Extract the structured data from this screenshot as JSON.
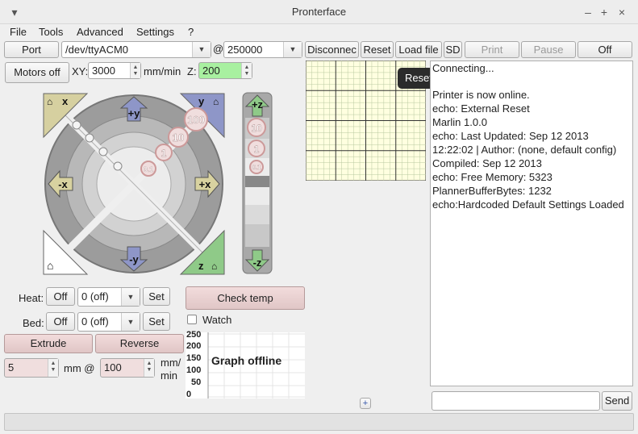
{
  "window": {
    "title": "Pronterface",
    "controls": [
      "▾",
      "–",
      "+",
      "×"
    ]
  },
  "menu": [
    "File",
    "Tools",
    "Advanced",
    "Settings",
    "?"
  ],
  "toolbar": {
    "port_label": "Port",
    "port_value": "/dev/ttyACM0",
    "at": "@",
    "baud_value": "250000",
    "disconnect_label": "Disconnec",
    "reset_label": "Reset",
    "load_label": "Load file",
    "sd_label": "SD",
    "print_label": "Print",
    "pause_label": "Pause",
    "off_label": "Off"
  },
  "motors": {
    "motors_off_label": "Motors off",
    "xy_label": "XY:",
    "xy_value": "3000",
    "mmmin_label": "mm/min",
    "z_label": "Z:",
    "z_value": "200"
  },
  "jog": {
    "home_x": "x",
    "home_y": "y",
    "home_z": "z",
    "plus_y": "+y",
    "minus_y": "-y",
    "plus_x": "+x",
    "minus_x": "-x",
    "plus_z": "+z",
    "minus_z": "-z",
    "steps": [
      "100",
      "10",
      "1",
      "0.1"
    ],
    "z_steps": [
      "10",
      "1",
      "0.1"
    ]
  },
  "temps": {
    "heat_label": "Heat:",
    "bed_label": "Bed:",
    "off_label": "Off",
    "heat_value": "0 (off)",
    "bed_value": "0 (off)",
    "set_label": "Set",
    "check_temp_label": "Check temp",
    "watch_label": "Watch"
  },
  "extrude": {
    "extrude_label": "Extrude",
    "reverse_label": "Reverse",
    "length_value": "5",
    "mm_at_label": "mm @",
    "speed_value": "100",
    "speed_unit_line1": "mm/",
    "speed_unit_line2": "min"
  },
  "graph": {
    "yticks": [
      "250",
      "200",
      "150",
      "100",
      "50",
      "0"
    ],
    "message": "Graph offline"
  },
  "tooltip": "Reset the printer",
  "log": [
    "Connecting...",
    "Printer is now online.",
    "echo: External Reset",
    "Marlin 1.0.0",
    "echo: Last Updated: Sep 12 2013",
    "12:22:02 | Author: (none, default config)",
    "Compiled: Sep 12 2013",
    "echo: Free Memory: 5323",
    "PlannerBufferBytes: 1232",
    "echo:Hardcoded Default Settings Loaded"
  ],
  "send_label": "Send",
  "add_button": "+",
  "colors": {
    "jog_y": "#8e96c8",
    "jog_x": "#d8d2a0",
    "jog_z": "#8fca88",
    "grid": "#ffffe0",
    "z_field": "#a8f0a0"
  }
}
